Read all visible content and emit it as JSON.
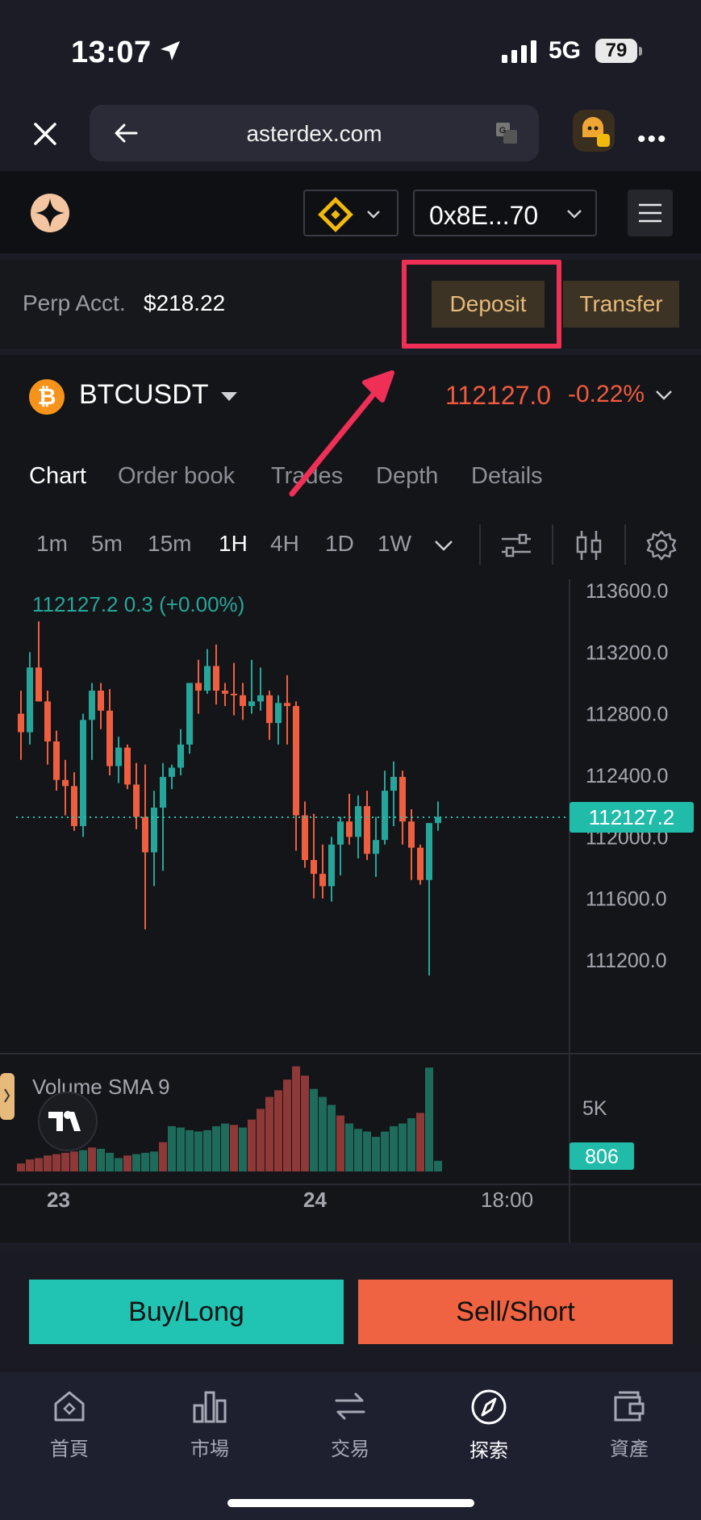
{
  "status_bar": {
    "time": "13:07",
    "network": "5G",
    "battery": "79"
  },
  "browser": {
    "url": "asterdex.com"
  },
  "header": {
    "wallet_address": "0x8E...70"
  },
  "account": {
    "label": "Perp Acct.",
    "value": "$218.22",
    "deposit_label": "Deposit",
    "transfer_label": "Transfer"
  },
  "symbol": {
    "pair": "BTCUSDT",
    "coin_glyph": "₿",
    "price": "112127.0",
    "change": "-0.22%"
  },
  "tabs": [
    "Chart",
    "Order book",
    "Trades",
    "Depth",
    "Details"
  ],
  "intervals": [
    "1m",
    "5m",
    "15m",
    "1H",
    "4H",
    "1D",
    "1W"
  ],
  "active_interval": "1H",
  "chart_data": {
    "type": "candlestick",
    "legend": "112127.2  0.3 (+0.00%)",
    "y_ticks": [
      "113600.0",
      "113200.0",
      "112800.0",
      "112400.0",
      "112000.0",
      "111600.0",
      "111200.0"
    ],
    "ylim": [
      111000,
      113650
    ],
    "current_price_label": "112127.2",
    "current_price": 112127.2,
    "x_ticks": [
      "23",
      "24",
      "18:00"
    ],
    "volume_label": "Volume SMA 9",
    "volume_ticks": [
      "5K"
    ],
    "volume_current_label": "806",
    "candles": [
      [
        112800,
        112950,
        112500,
        112680
      ],
      [
        112680,
        113200,
        112600,
        113100
      ],
      [
        113100,
        113400,
        112950,
        112880
      ],
      [
        112880,
        112950,
        112470,
        112620
      ],
      [
        112620,
        112690,
        112300,
        112370
      ],
      [
        112370,
        112500,
        112140,
        112330
      ],
      [
        112330,
        112420,
        112040,
        112070
      ],
      [
        112070,
        112800,
        112000,
        112760
      ],
      [
        112760,
        113000,
        112500,
        112950
      ],
      [
        112950,
        113000,
        112700,
        112820
      ],
      [
        112820,
        112960,
        112400,
        112460
      ],
      [
        112460,
        112650,
        112350,
        112580
      ],
      [
        112580,
        112600,
        112310,
        112340
      ],
      [
        112340,
        112480,
        112050,
        112130
      ],
      [
        112130,
        112470,
        111400,
        111900
      ],
      [
        111900,
        112300,
        111680,
        112190
      ],
      [
        112190,
        112480,
        111780,
        112390
      ],
      [
        112390,
        112470,
        112310,
        112450
      ],
      [
        112450,
        112700,
        112400,
        112600
      ],
      [
        112600,
        112950,
        112540,
        113000
      ],
      [
        113000,
        113150,
        112800,
        112950
      ],
      [
        112950,
        113220,
        112930,
        113110
      ],
      [
        113110,
        113250,
        112860,
        112950
      ],
      [
        112950,
        113000,
        112850,
        112930
      ],
      [
        112930,
        113130,
        112790,
        112920
      ],
      [
        112920,
        113000,
        112760,
        112850
      ],
      [
        112850,
        113150,
        112800,
        112880
      ],
      [
        112880,
        113100,
        112820,
        112920
      ],
      [
        112920,
        112950,
        112630,
        112740
      ],
      [
        112740,
        112920,
        112600,
        112870
      ],
      [
        112870,
        113050,
        112600,
        112850
      ],
      [
        112850,
        112880,
        111910,
        112140
      ],
      [
        112140,
        112230,
        111800,
        111850
      ],
      [
        111850,
        112150,
        111600,
        111760
      ],
      [
        111760,
        111950,
        111600,
        111680
      ],
      [
        111680,
        112000,
        111580,
        111950
      ],
      [
        111950,
        112130,
        111750,
        112100
      ],
      [
        112100,
        112280,
        111950,
        112000
      ],
      [
        112000,
        112270,
        111860,
        112200
      ],
      [
        112200,
        112300,
        111850,
        111890
      ],
      [
        111890,
        112130,
        111740,
        111980
      ],
      [
        111980,
        112430,
        111950,
        112300
      ],
      [
        112300,
        112490,
        112070,
        112390
      ],
      [
        112390,
        112430,
        111950,
        112100
      ],
      [
        112100,
        112180,
        111720,
        111930
      ],
      [
        111930,
        111950,
        111690,
        111720
      ],
      [
        111720,
        111200,
        111100,
        112090
      ],
      [
        112090,
        112230,
        112040,
        112130
      ]
    ],
    "volumes": [
      [
        300,
        "r"
      ],
      [
        450,
        "r"
      ],
      [
        500,
        "r"
      ],
      [
        600,
        "r"
      ],
      [
        650,
        "r"
      ],
      [
        700,
        "r"
      ],
      [
        750,
        "r"
      ],
      [
        800,
        "g"
      ],
      [
        900,
        "r"
      ],
      [
        850,
        "g"
      ],
      [
        700,
        "g"
      ],
      [
        500,
        "g"
      ],
      [
        600,
        "r"
      ],
      [
        650,
        "g"
      ],
      [
        700,
        "g"
      ],
      [
        750,
        "g"
      ],
      [
        1100,
        "r"
      ],
      [
        1700,
        "g"
      ],
      [
        1650,
        "g"
      ],
      [
        1550,
        "g"
      ],
      [
        1500,
        "g"
      ],
      [
        1550,
        "g"
      ],
      [
        1700,
        "g"
      ],
      [
        1800,
        "g"
      ],
      [
        1750,
        "r"
      ],
      [
        1650,
        "g"
      ],
      [
        1950,
        "r"
      ],
      [
        2350,
        "r"
      ],
      [
        2800,
        "r"
      ],
      [
        3050,
        "r"
      ],
      [
        3450,
        "r"
      ],
      [
        3950,
        "r"
      ],
      [
        3600,
        "r"
      ],
      [
        3100,
        "g"
      ],
      [
        2800,
        "g"
      ],
      [
        2500,
        "g"
      ],
      [
        2100,
        "r"
      ],
      [
        1800,
        "g"
      ],
      [
        1600,
        "g"
      ],
      [
        1500,
        "g"
      ],
      [
        1300,
        "g"
      ],
      [
        1500,
        "g"
      ],
      [
        1700,
        "g"
      ],
      [
        1800,
        "g"
      ],
      [
        2000,
        "g"
      ],
      [
        2200,
        "r"
      ],
      [
        3900,
        "g"
      ],
      [
        400,
        "g"
      ]
    ]
  },
  "trade": {
    "buy_label": "Buy/Long",
    "sell_label": "Sell/Short"
  },
  "nav": [
    {
      "label": "首頁",
      "icon": "home-icon"
    },
    {
      "label": "市場",
      "icon": "market-icon"
    },
    {
      "label": "交易",
      "icon": "swap-icon"
    },
    {
      "label": "探索",
      "icon": "compass-icon"
    },
    {
      "label": "資產",
      "icon": "wallet-icon"
    }
  ],
  "colors": {
    "up": "#26a69a",
    "down": "#ef5f3f",
    "accent": "#e7b97a",
    "annotation": "#ef2f56"
  }
}
